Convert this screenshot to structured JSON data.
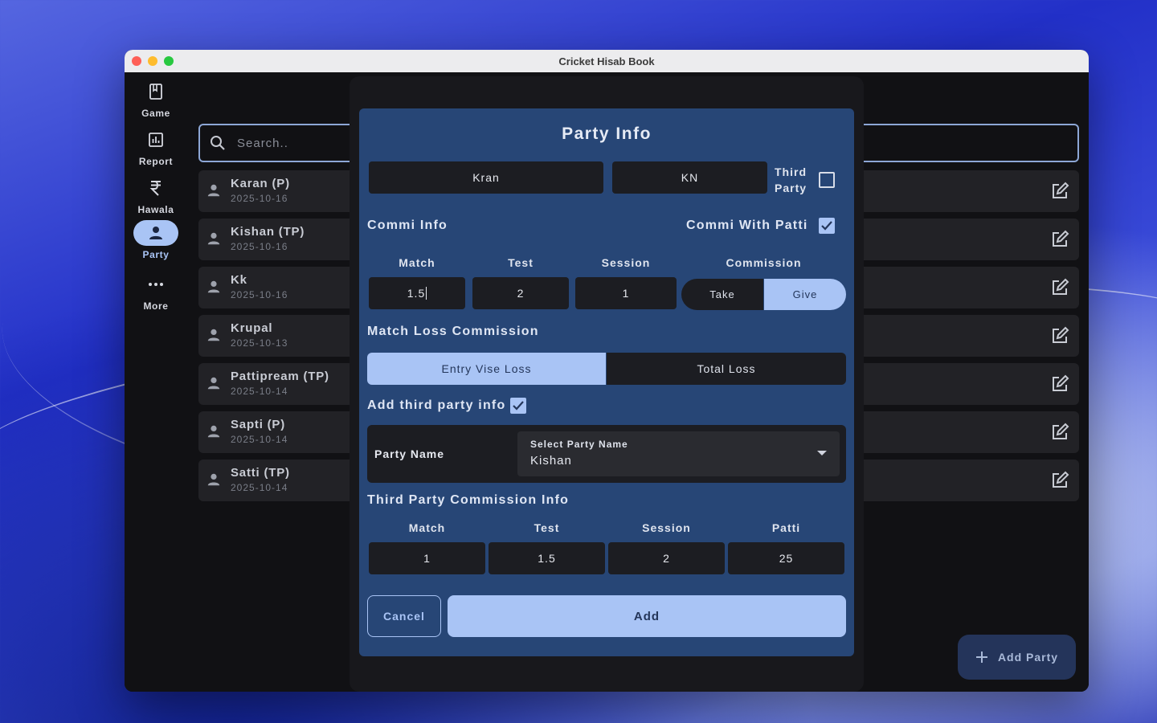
{
  "window": {
    "title": "Cricket Hisab Book"
  },
  "rail": [
    {
      "label": "Game",
      "icon": "bookmark-icon"
    },
    {
      "label": "Report",
      "icon": "chart-icon"
    },
    {
      "label": "Hawala",
      "icon": "rupee-icon"
    },
    {
      "label": "Party",
      "icon": "person-icon",
      "active": true
    },
    {
      "label": "More",
      "icon": "more-dots-icon"
    }
  ],
  "search": {
    "placeholder": "Search.."
  },
  "parties": [
    {
      "name": "Karan (P)",
      "date": "2025-10-16"
    },
    {
      "name": "Kishan (TP)",
      "date": "2025-10-16"
    },
    {
      "name": "Kk",
      "date": "2025-10-16"
    },
    {
      "name": "Krupal",
      "date": "2025-10-13"
    },
    {
      "name": "Pattipream (TP)",
      "date": "2025-10-14"
    },
    {
      "name": "Sapti (P)",
      "date": "2025-10-14"
    },
    {
      "name": "Satti (TP)",
      "date": "2025-10-14"
    }
  ],
  "fab": {
    "label": "Add Party"
  },
  "dialog": {
    "title": "Party Info",
    "name_value": "Kran",
    "short_value": "KN",
    "third_party_label_1": "Third",
    "third_party_label_2": "Party",
    "third_party_checked": false,
    "commi_info_label": "Commi Info",
    "commi_with_patti_label": "Commi With Patti",
    "commi_with_patti_checked": true,
    "col_match": "Match",
    "col_test": "Test",
    "col_session": "Session",
    "col_commission": "Commission",
    "match_value": "1.5",
    "test_value": "2",
    "session_value": "1",
    "take_label": "Take",
    "give_label": "Give",
    "commission_selected": "Give",
    "match_loss_label": "Match Loss Commission",
    "entry_vise_label": "Entry Vise Loss",
    "total_loss_label": "Total Loss",
    "match_loss_selected": "Entry Vise Loss",
    "add_third_party_label": "Add third party info",
    "add_third_party_checked": true,
    "party_name_label": "Party Name",
    "select_label": "Select Party Name",
    "select_value": "Kishan",
    "tp_commission_label": "Third Party Commission Info",
    "tp_col_match": "Match",
    "tp_col_test": "Test",
    "tp_col_session": "Session",
    "tp_col_patti": "Patti",
    "tp_match_value": "1",
    "tp_test_value": "1.5",
    "tp_session_value": "2",
    "tp_patti_value": "25",
    "cancel_label": "Cancel",
    "add_label": "Add"
  },
  "colors": {
    "accent": "#a9c4f5",
    "dialog_bg": "#274676",
    "field_bg": "#1c1d22"
  }
}
